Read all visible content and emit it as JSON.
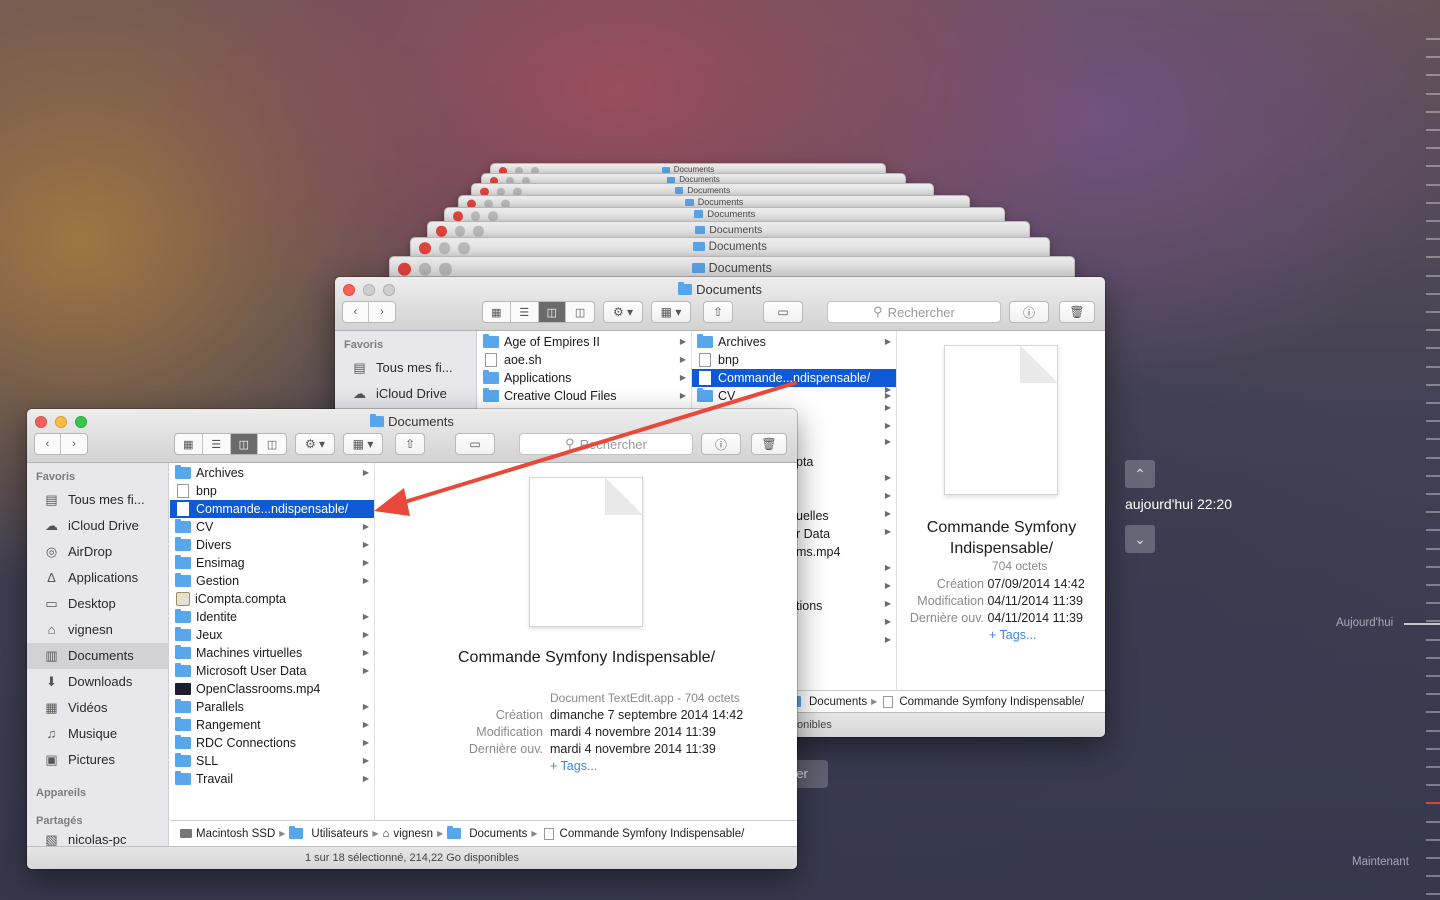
{
  "window_title": "Documents",
  "search_placeholder": "Rechercher",
  "ghost_titles": [
    "Documents",
    "Documents",
    "Documents",
    "Documents",
    "Documents",
    "Documents",
    "Documents",
    "Documents"
  ],
  "sidebar": {
    "favorites_heading": "Favoris",
    "items": [
      {
        "label": "Tous mes fi...",
        "icon": "all-files-icon"
      },
      {
        "label": "iCloud Drive",
        "icon": "cloud-icon"
      },
      {
        "label": "AirDrop",
        "icon": "airdrop-icon"
      },
      {
        "label": "Applications",
        "icon": "applications-icon"
      },
      {
        "label": "Desktop",
        "icon": "desktop-icon"
      },
      {
        "label": "vignesn",
        "icon": "home-icon"
      },
      {
        "label": "Documents",
        "icon": "documents-icon"
      },
      {
        "label": "Downloads",
        "icon": "downloads-icon"
      },
      {
        "label": "Vidéos",
        "icon": "film-icon"
      },
      {
        "label": "Musique",
        "icon": "music-icon"
      },
      {
        "label": "Pictures",
        "icon": "camera-icon"
      }
    ],
    "devices_heading": "Appareils",
    "shared_heading": "Partagés",
    "shared_item": "nicolas-pc"
  },
  "front": {
    "files": [
      {
        "name": "Archives",
        "kind": "folder",
        "chevron": true
      },
      {
        "name": "bnp",
        "kind": "doc",
        "chevron": false
      },
      {
        "name": "Commande...ndispensable/",
        "kind": "doc",
        "chevron": false,
        "selected": true
      },
      {
        "name": "CV",
        "kind": "folder",
        "chevron": true
      },
      {
        "name": "Divers",
        "kind": "folder",
        "chevron": true
      },
      {
        "name": "Ensimag",
        "kind": "folder",
        "chevron": true
      },
      {
        "name": "Gestion",
        "kind": "folder",
        "chevron": true
      },
      {
        "name": "iCompta.compta",
        "kind": "app",
        "chevron": false
      },
      {
        "name": "Identite",
        "kind": "folder",
        "chevron": true
      },
      {
        "name": "Jeux",
        "kind": "folder",
        "chevron": true
      },
      {
        "name": "Machines virtuelles",
        "kind": "folder",
        "chevron": true
      },
      {
        "name": "Microsoft User Data",
        "kind": "folder",
        "chevron": true
      },
      {
        "name": "OpenClassrooms.mp4",
        "kind": "video",
        "chevron": false
      },
      {
        "name": "Parallels",
        "kind": "folder",
        "chevron": true
      },
      {
        "name": "Rangement",
        "kind": "folder",
        "chevron": true
      },
      {
        "name": "RDC Connections",
        "kind": "folder",
        "chevron": true
      },
      {
        "name": "SLL",
        "kind": "folder",
        "chevron": true
      },
      {
        "name": "Travail",
        "kind": "folder",
        "chevron": true
      }
    ],
    "preview": {
      "name": "Commande Symfony Indispensable/",
      "kind_size": "Document TextEdit.app - 704 octets",
      "created_label": "Création",
      "created": "dimanche 7 septembre 2014 14:42",
      "modified_label": "Modification",
      "modified": "mardi 4 novembre 2014 11:39",
      "opened_label": "Dernière ouv.",
      "opened": "mardi 4 novembre 2014 11:39",
      "tags": "+ Tags..."
    },
    "path": [
      "Macintosh SSD",
      "Utilisateurs",
      "vignesn",
      "Documents",
      "Commande Symfony Indispensable/"
    ],
    "status": "1 sur 18 sélectionné, 214,22 Go disponibles"
  },
  "back": {
    "sidebar_items": [
      "Tous mes fi...",
      "iCloud Drive"
    ],
    "col1": [
      {
        "name": "Age of Empires II",
        "kind": "folder"
      },
      {
        "name": "aoe.sh",
        "kind": "doc"
      },
      {
        "name": "Applications",
        "kind": "folder"
      },
      {
        "name": "Creative Cloud Files",
        "kind": "folder"
      }
    ],
    "col2": [
      {
        "name": "Archives",
        "kind": "folder",
        "chevron": true
      },
      {
        "name": "bnp",
        "kind": "doc",
        "chevron": false
      },
      {
        "name": "Commande...ndispensable/",
        "kind": "doc",
        "chevron": false,
        "selected": true
      },
      {
        "name": "CV",
        "kind": "folder",
        "chevron": true
      }
    ],
    "col2_partial": [
      "pta",
      "uelles",
      "r Data",
      "ms.mp4",
      "tions"
    ],
    "preview": {
      "name": "Commande Symfony Indispensable/",
      "size": "704 octets",
      "created_label": "Création",
      "created": "07/09/2014 14:42",
      "modified_label": "Modification",
      "modified": "04/11/2014 11:39",
      "opened_label": "Dernière ouv.",
      "opened": "04/11/2014 11:39",
      "tags": "+ Tags..."
    },
    "path_tail": [
      "Documents",
      "Commande Symfony Indispensable/"
    ],
    "status_partial": "onibles",
    "restore_partial": "rer"
  },
  "timemachine": {
    "date": "aujourd'hui 22:20",
    "today_label": "Aujourd'hui",
    "now_label": "Maintenant"
  },
  "colors": {
    "selection": "#0e5ad6",
    "arrow": "#e8493a",
    "folder": "#58a7ed"
  }
}
